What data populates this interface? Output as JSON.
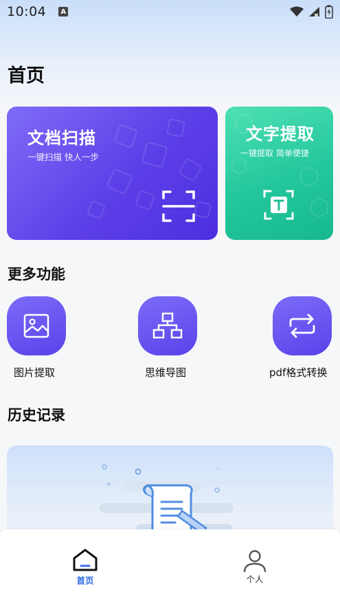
{
  "status_bar": {
    "time": "10:04",
    "notification_icon": "A"
  },
  "page": {
    "title": "首页"
  },
  "cards": [
    {
      "title": "文档扫描",
      "subtitle": "一键扫描 快人一步",
      "icon": "scan-frame-icon",
      "color": "#5d3fe8"
    },
    {
      "title": "文字提取",
      "subtitle": "一键提取 简单便捷",
      "icon": "text-recognize-icon",
      "color": "#24c79c"
    }
  ],
  "more": {
    "title": "更多功能",
    "items": [
      {
        "label": "图片提取",
        "icon": "image-icon"
      },
      {
        "label": "思维导图",
        "icon": "mind-map-icon"
      },
      {
        "label": "pdf格式转换",
        "icon": "convert-icon"
      }
    ]
  },
  "history": {
    "title": "历史记录"
  },
  "tabbar": {
    "items": [
      {
        "label": "首页",
        "icon": "home-icon",
        "active": true
      },
      {
        "label": "个人",
        "icon": "person-icon",
        "active": false
      }
    ],
    "active_color": "#2f6be4"
  }
}
